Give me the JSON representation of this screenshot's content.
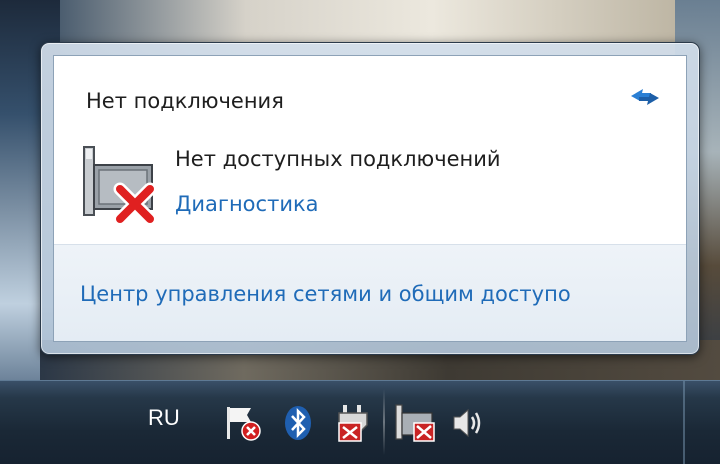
{
  "flyout": {
    "title": "Нет подключения",
    "status_text": "Нет доступных подключений",
    "diagnostics_link": "Диагностика",
    "network_center_link": "Центр управления сетями и общим доступо"
  },
  "taskbar": {
    "language": "RU"
  },
  "icons": {
    "refresh": "refresh-arrows-icon",
    "network_disconnected": "network-disconnected-icon",
    "action_center": "action-center-flag-icon",
    "bluetooth": "bluetooth-icon",
    "power": "power-plug-icon",
    "network_tray": "network-tray-icon",
    "volume": "volume-icon"
  },
  "colors": {
    "link": "#1f6bb8",
    "error_red": "#e02020",
    "taskbar": "#1a2836"
  }
}
